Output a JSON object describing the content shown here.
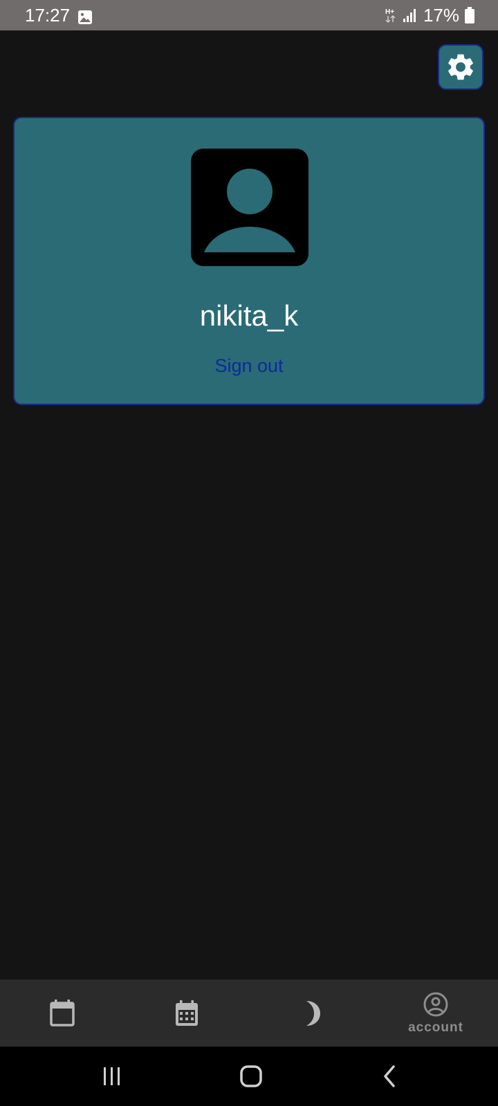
{
  "status_bar": {
    "time": "17:27",
    "battery_text": "17%",
    "icons": [
      "gallery-icon",
      "network-hplus-icon",
      "signal-icon",
      "battery-icon"
    ]
  },
  "settings": {
    "icon": "gear-icon"
  },
  "account_card": {
    "username": "nikita_k",
    "sign_out_label": "Sign out",
    "avatar_icon": "person-icon"
  },
  "bottom_nav": {
    "items": [
      {
        "icon": "calendar-blank-icon",
        "label": ""
      },
      {
        "icon": "calendar-grid-icon",
        "label": ""
      },
      {
        "icon": "moon-icon",
        "label": ""
      },
      {
        "icon": "account-circle-icon",
        "label": "account",
        "active": true
      }
    ]
  },
  "colors": {
    "background": "#141414",
    "card": "#2a6b76",
    "card_border": "#1a2a8c",
    "link": "#0d2a9c",
    "status_bar": "#706c6c",
    "bottom_nav": "#2b2b2b"
  }
}
